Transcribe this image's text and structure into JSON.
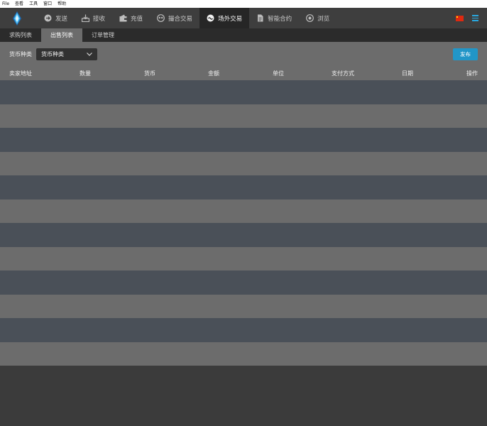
{
  "menubar": {
    "items": [
      "File",
      "查看",
      "工具",
      "窗口",
      "帮助"
    ]
  },
  "nav": {
    "items": [
      {
        "label": "发送",
        "icon": "send-icon"
      },
      {
        "label": "接收",
        "icon": "receive-icon"
      },
      {
        "label": "充值",
        "icon": "wallet-icon"
      },
      {
        "label": "撮合交易",
        "icon": "match-trade-icon"
      },
      {
        "label": "场外交易",
        "icon": "otc-trade-icon"
      },
      {
        "label": "智能合约",
        "icon": "contract-icon"
      },
      {
        "label": "浏览",
        "icon": "browse-icon"
      }
    ],
    "active_index": 4,
    "language_flag": "cn-flag-icon",
    "accent": "#29a8e0"
  },
  "subtabs": {
    "items": [
      "求购列表",
      "出售列表",
      "订单管理"
    ],
    "active_index": 1
  },
  "filter": {
    "label": "货币种类",
    "select_value": "货币种类",
    "publish_label": "发布",
    "publish_color": "#2196c8"
  },
  "table": {
    "columns": [
      "卖家地址",
      "数量",
      "货币",
      "金额",
      "单位",
      "支付方式",
      "日期",
      "操作"
    ],
    "row_count": 12,
    "row_colors": [
      "#4a5058",
      "#6c6c6c"
    ]
  }
}
